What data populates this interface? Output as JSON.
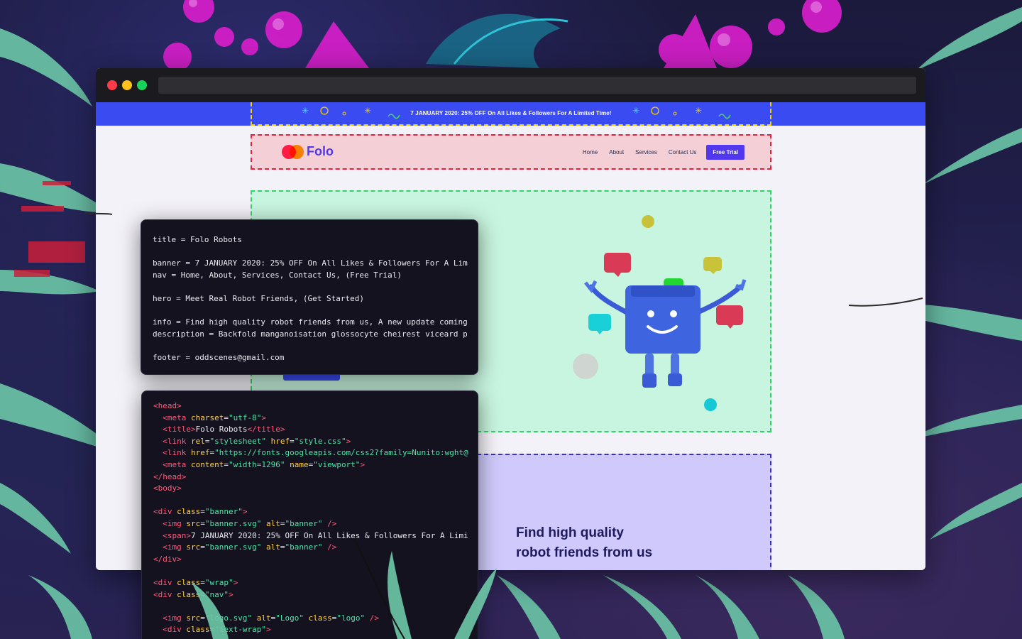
{
  "site": {
    "banner": "7 JANUARY 2020: 25% OFF On All Likes & Followers For A Limited Time!",
    "logo_text": "Folo",
    "nav": [
      "Home",
      "About",
      "Services",
      "Contact Us"
    ],
    "nav_button": "Free Trial",
    "info_title_line1": "Find high quality",
    "info_title_line2": "robot friends from us"
  },
  "config_panel": {
    "lines": [
      "title = Folo Robots",
      "",
      "banner = 7 JANUARY 2020: 25% OFF On All Likes & Followers For A Lim",
      "nav = Home, About, Services, Contact Us, (Free Trial)",
      "",
      "hero = Meet Real Robot Friends, (Get Started)",
      "",
      "info = Find high quality robot friends from us, A new update coming",
      "description = Backfold manganoisation glossocyte cheirest viceard p",
      "",
      "footer = oddscenes@gmail.com"
    ]
  },
  "code_panel": {
    "lines": [
      [
        [
          "t",
          "<"
        ],
        [
          "t",
          "head"
        ],
        [
          "t",
          ">"
        ]
      ],
      [
        [
          "p",
          "  "
        ],
        [
          "t",
          "<"
        ],
        [
          "t",
          "meta "
        ],
        [
          "a",
          "charset"
        ],
        [
          "p",
          "="
        ],
        [
          "s",
          "\"utf-8\""
        ],
        [
          "t",
          ">"
        ]
      ],
      [
        [
          "p",
          "  "
        ],
        [
          "t",
          "<"
        ],
        [
          "t",
          "title"
        ],
        [
          "t",
          ">"
        ],
        [
          "p",
          "Folo Robots"
        ],
        [
          "t",
          "</"
        ],
        [
          "t",
          "title"
        ],
        [
          "t",
          ">"
        ]
      ],
      [
        [
          "p",
          "  "
        ],
        [
          "t",
          "<"
        ],
        [
          "t",
          "link "
        ],
        [
          "a",
          "rel"
        ],
        [
          "p",
          "="
        ],
        [
          "s",
          "\"stylesheet\" "
        ],
        [
          "a",
          "href"
        ],
        [
          "p",
          "="
        ],
        [
          "s",
          "\"style.css\""
        ],
        [
          "t",
          ">"
        ]
      ],
      [
        [
          "p",
          "  "
        ],
        [
          "t",
          "<"
        ],
        [
          "t",
          "link "
        ],
        [
          "a",
          "href"
        ],
        [
          "p",
          "="
        ],
        [
          "s",
          "\"https://fonts.googleapis.com/css2?family=Nunito:wght@"
        ]
      ],
      [
        [
          "p",
          "  "
        ],
        [
          "t",
          "<"
        ],
        [
          "t",
          "meta "
        ],
        [
          "a",
          "content"
        ],
        [
          "p",
          "="
        ],
        [
          "s",
          "\"width=1296\" "
        ],
        [
          "a",
          "name"
        ],
        [
          "p",
          "="
        ],
        [
          "s",
          "\"viewport\""
        ],
        [
          "t",
          ">"
        ]
      ],
      [
        [
          "t",
          "</"
        ],
        [
          "t",
          "head"
        ],
        [
          "t",
          ">"
        ]
      ],
      [
        [
          "t",
          "<"
        ],
        [
          "t",
          "body"
        ],
        [
          "t",
          ">"
        ]
      ],
      [],
      [
        [
          "t",
          "<"
        ],
        [
          "t",
          "div "
        ],
        [
          "a",
          "class"
        ],
        [
          "p",
          "="
        ],
        [
          "s",
          "\"banner\""
        ],
        [
          "t",
          ">"
        ]
      ],
      [
        [
          "p",
          "  "
        ],
        [
          "t",
          "<"
        ],
        [
          "t",
          "img "
        ],
        [
          "a",
          "src"
        ],
        [
          "p",
          "="
        ],
        [
          "s",
          "\"banner.svg\" "
        ],
        [
          "a",
          "alt"
        ],
        [
          "p",
          "="
        ],
        [
          "s",
          "\"banner\" "
        ],
        [
          "t",
          "/>"
        ]
      ],
      [
        [
          "p",
          "  "
        ],
        [
          "t",
          "<"
        ],
        [
          "t",
          "span"
        ],
        [
          "t",
          ">"
        ],
        [
          "p",
          "7 JANUARY 2020: 25% OFF On All Likes & Followers For A Limi"
        ]
      ],
      [
        [
          "p",
          "  "
        ],
        [
          "t",
          "<"
        ],
        [
          "t",
          "img "
        ],
        [
          "a",
          "src"
        ],
        [
          "p",
          "="
        ],
        [
          "s",
          "\"banner.svg\" "
        ],
        [
          "a",
          "alt"
        ],
        [
          "p",
          "="
        ],
        [
          "s",
          "\"banner\" "
        ],
        [
          "t",
          "/>"
        ]
      ],
      [
        [
          "t",
          "</"
        ],
        [
          "t",
          "div"
        ],
        [
          "t",
          ">"
        ]
      ],
      [],
      [
        [
          "t",
          "<"
        ],
        [
          "t",
          "div "
        ],
        [
          "a",
          "class"
        ],
        [
          "p",
          "="
        ],
        [
          "s",
          "\"wrap\""
        ],
        [
          "t",
          ">"
        ]
      ],
      [
        [
          "t",
          "<"
        ],
        [
          "t",
          "div "
        ],
        [
          "a",
          "class"
        ],
        [
          "p",
          "="
        ],
        [
          "s",
          "\"nav\""
        ],
        [
          "t",
          ">"
        ]
      ],
      [],
      [
        [
          "p",
          "  "
        ],
        [
          "t",
          "<"
        ],
        [
          "t",
          "img "
        ],
        [
          "a",
          "src"
        ],
        [
          "p",
          "="
        ],
        [
          "s",
          "\"logo.svg\" "
        ],
        [
          "a",
          "alt"
        ],
        [
          "p",
          "="
        ],
        [
          "s",
          "\"Logo\" "
        ],
        [
          "a",
          "class"
        ],
        [
          "p",
          "="
        ],
        [
          "s",
          "\"logo\" "
        ],
        [
          "t",
          "/>"
        ]
      ],
      [
        [
          "p",
          "  "
        ],
        [
          "t",
          "<"
        ],
        [
          "t",
          "div "
        ],
        [
          "a",
          "class"
        ],
        [
          "p",
          "="
        ],
        [
          "s",
          "\"text-wrap\""
        ],
        [
          "t",
          ">"
        ]
      ]
    ]
  },
  "colors": {
    "brand": "#5138ee",
    "banner_bg": "#3a4bf2",
    "hero_bg": "#c8f5df",
    "info_bg": "#cfcafb",
    "nav_bg": "#f4cfd6"
  }
}
